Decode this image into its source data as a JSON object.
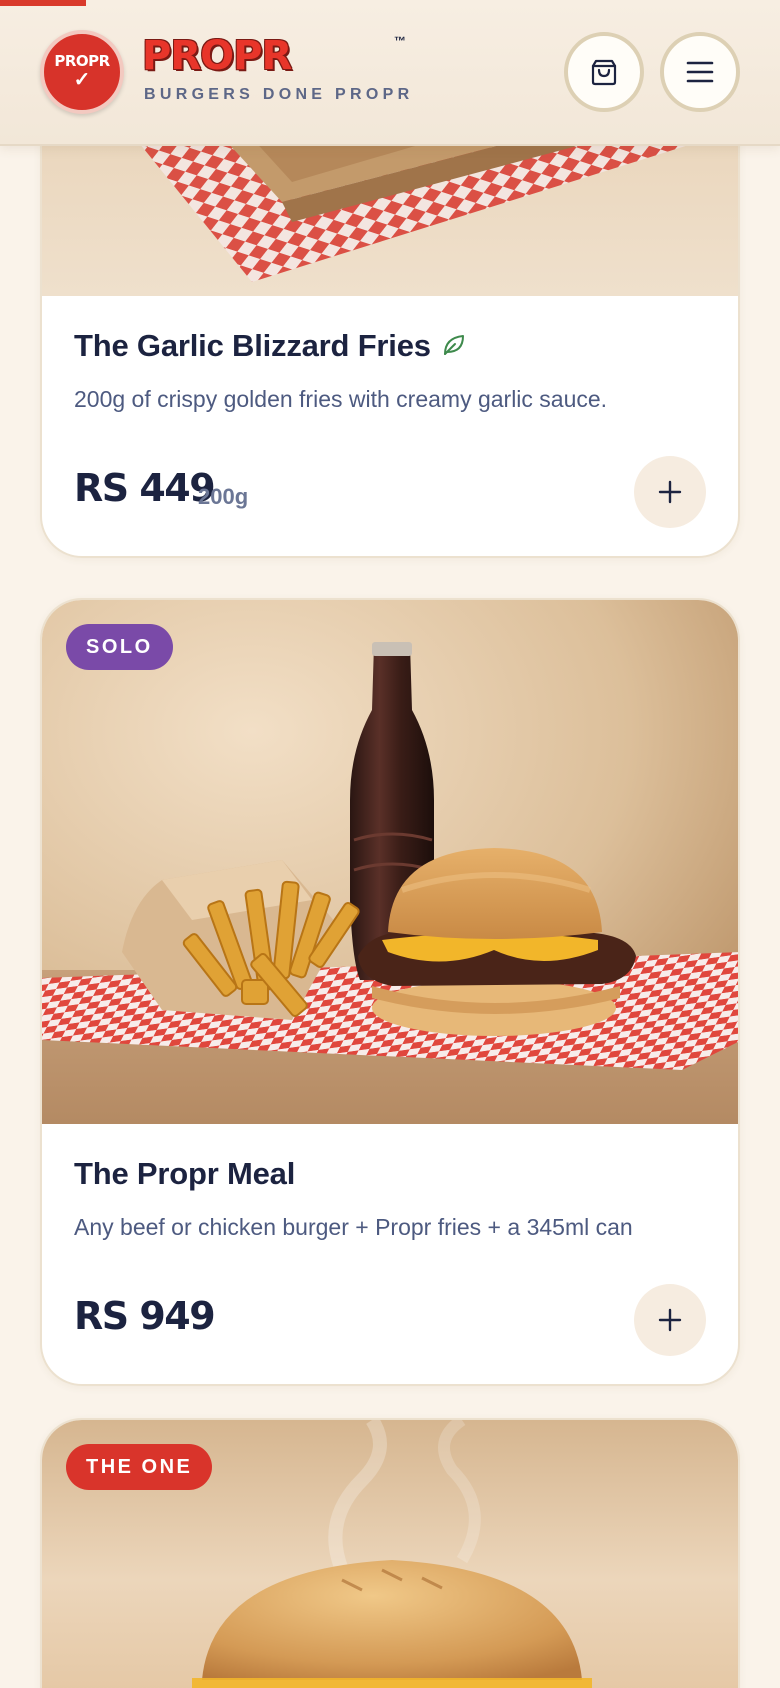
{
  "header": {
    "logo_badge_text": "PROPR",
    "logo_check": "✓",
    "brand_name": "PROPR",
    "trademark": "™",
    "tagline": "BURGERS DONE PROPR",
    "cart_icon": "shopping-bag-icon",
    "menu_icon": "hamburger-menu-icon"
  },
  "colors": {
    "background": "#faf3ea",
    "brand_red": "#d9342b",
    "text_dark": "#1c2340",
    "text_muted": "#4d5a80",
    "tag_purple": "#7a4aa8",
    "add_button_bg": "#f6ece0",
    "veg_leaf": "#3e8a4c"
  },
  "menu": {
    "items": [
      {
        "title": "The Garlic Blizzard Fries",
        "veg_icon": "leaf-icon",
        "description": "200g of crispy golden fries with creamy garlic sauce.",
        "price": "RS 449",
        "weight": "200g",
        "add_icon": "plus-icon"
      },
      {
        "tag": "SOLO",
        "title": "The Propr Meal",
        "description": "Any beef or chicken burger + Propr fries + a 345ml can",
        "price": "RS 949",
        "add_icon": "plus-icon"
      },
      {
        "tag": "THE ONE"
      }
    ]
  }
}
